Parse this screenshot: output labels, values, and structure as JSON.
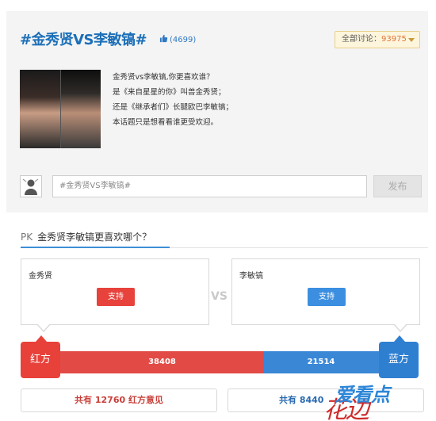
{
  "topic": {
    "title": "#金秀贤VS李敏镐#",
    "likes": "(4699)",
    "discuss_label": "全部讨论：",
    "discuss_count": "93975",
    "description": [
      "金秀贤vs李敏镐,你更喜欢谁？",
      "是《来自星星的你》叫兽金秀贤；",
      "还是《继承者们》长腿欧巴李敏镐；",
      "本话题只是想看看谁更受欢迎。"
    ],
    "post_placeholder": "#金秀贤VS李敏镐#",
    "post_button": "发布"
  },
  "pk": {
    "tag": "PK",
    "question": "金秀贤李敏镐更喜欢哪个？",
    "vs": "VS",
    "left": {
      "name": "金秀贤",
      "button": "支持",
      "side_label": "红方",
      "votes": "38408",
      "votes_value": 38408,
      "opinions": "共有 12760 红方意见"
    },
    "right": {
      "name": "李敏镐",
      "button": "支持",
      "side_label": "蓝方",
      "votes": "21514",
      "votes_value": 21514,
      "opinions": "共有 8440"
    }
  },
  "watermark": {
    "text_a": "花边",
    "text_b": "爱看点"
  },
  "colors": {
    "red": "#e7413a",
    "blue": "#2f7fd1",
    "title": "#1c6fb8"
  }
}
